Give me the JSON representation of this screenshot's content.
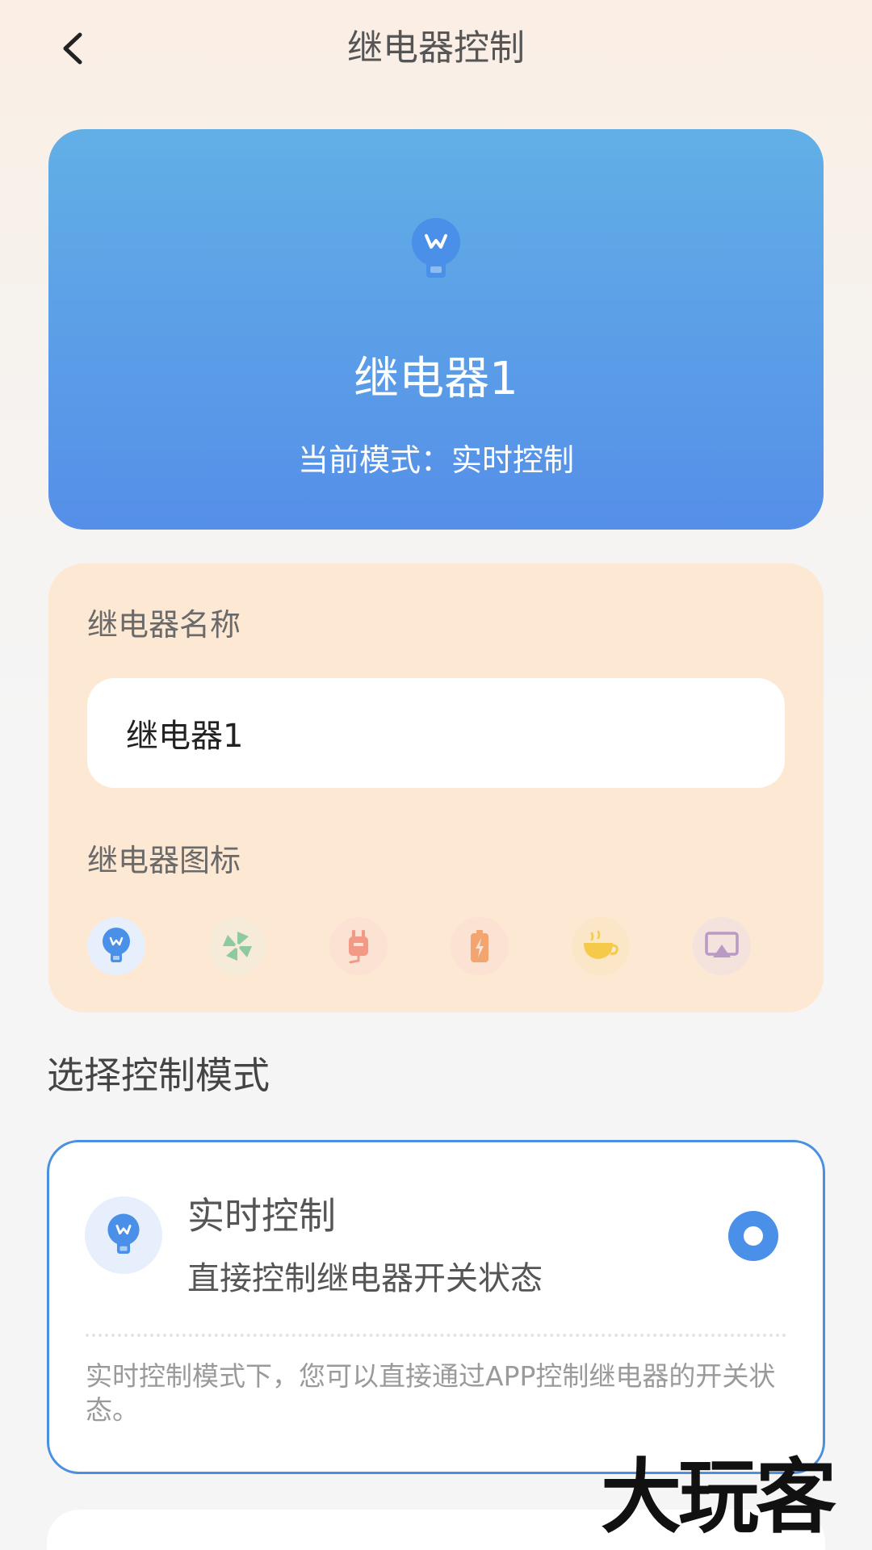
{
  "header": {
    "title": "继电器控制",
    "back_icon": "chevron-left-icon"
  },
  "hero": {
    "icon": "lightbulb-icon",
    "name": "继电器1",
    "mode_text": "当前模式：实时控制"
  },
  "settings": {
    "name_label": "继电器名称",
    "name_value": "继电器1",
    "icon_label": "继电器图标",
    "icons": [
      {
        "name": "lightbulb-icon",
        "color": "#4a8fe8",
        "bg": "#e6effb",
        "selected": true
      },
      {
        "name": "fan-icon",
        "color": "#8ec9a0",
        "bg": "#f6ead8",
        "selected": false
      },
      {
        "name": "plug-icon",
        "color": "#f29a86",
        "bg": "#fbe2d2",
        "selected": false
      },
      {
        "name": "battery-icon",
        "color": "#f2a56f",
        "bg": "#fbe2d2",
        "selected": false
      },
      {
        "name": "coffee-cup-icon",
        "color": "#f5c94a",
        "bg": "#fbe6c8",
        "selected": false
      },
      {
        "name": "screen-cast-icon",
        "color": "#b89ac4",
        "bg": "#f4e2dc",
        "selected": false
      }
    ]
  },
  "control_mode": {
    "section_title": "选择控制模式",
    "options": [
      {
        "title": "实时控制",
        "description": "直接控制继电器开关状态",
        "note": "实时控制模式下，您可以直接通过APP控制继电器的开关状态。",
        "selected": true,
        "icon": "lightbulb-icon"
      }
    ]
  },
  "watermark": "大玩客",
  "colors": {
    "accent": "#4a8fe8",
    "hero_top": "#62afe6",
    "hero_bottom": "#558fe8",
    "settings_bg": "#fde8d4"
  }
}
